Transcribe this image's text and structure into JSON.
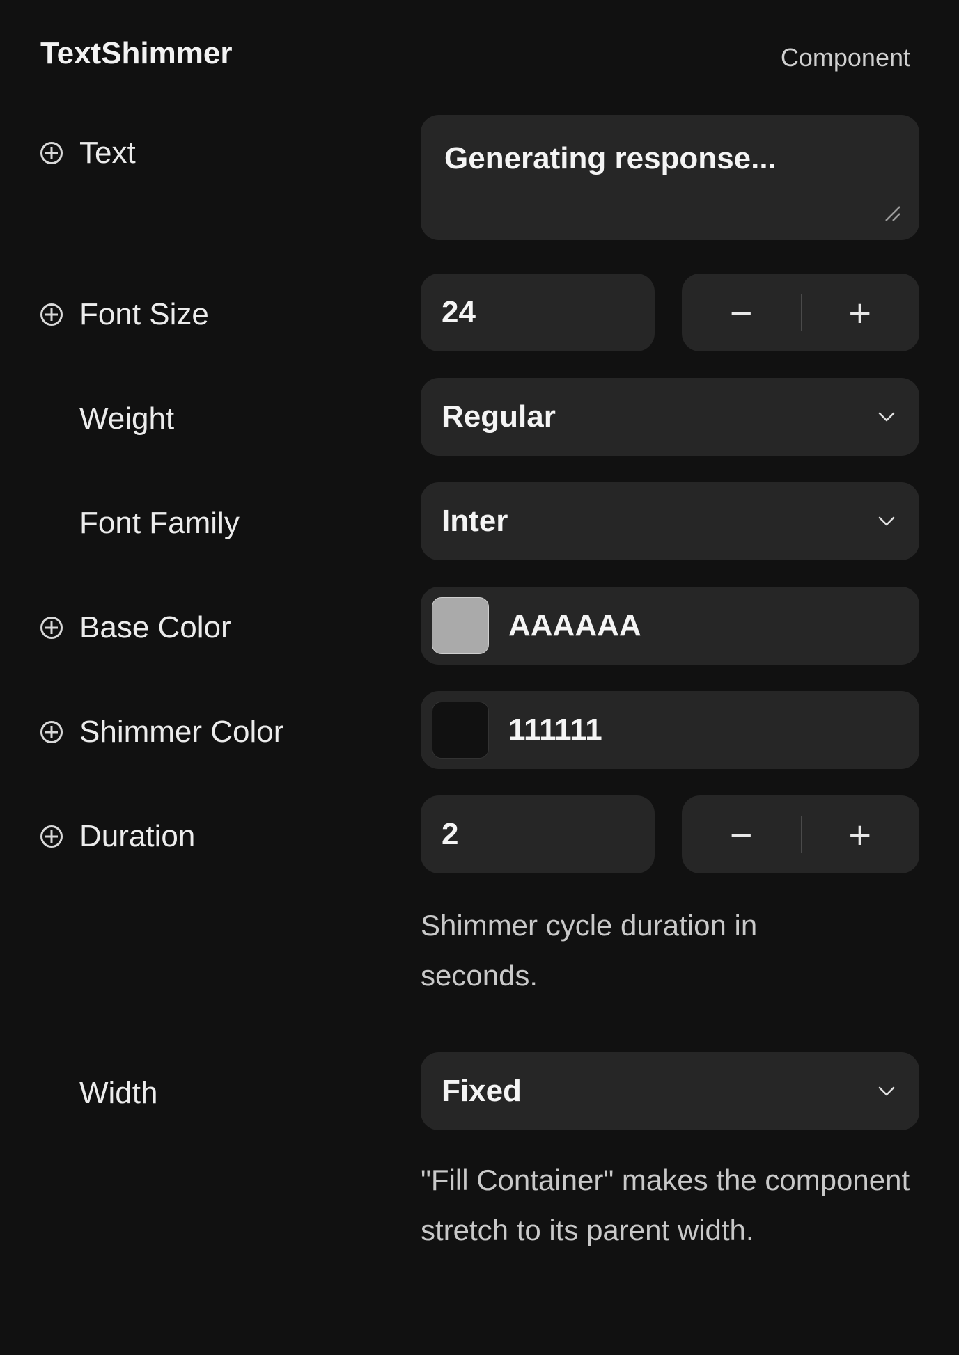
{
  "header": {
    "title": "TextShimmer",
    "subtitle": "Component"
  },
  "properties": {
    "text": {
      "label": "Text",
      "value": "Generating response..."
    },
    "font_size": {
      "label": "Font Size",
      "value": "24",
      "minus": "−",
      "plus": "+"
    },
    "weight": {
      "label": "Weight",
      "value": "Regular"
    },
    "font_family": {
      "label": "Font Family",
      "value": "Inter"
    },
    "base_color": {
      "label": "Base Color",
      "value": "AAAAAA",
      "swatch": "#AAAAAA"
    },
    "shimmer_color": {
      "label": "Shimmer Color",
      "value": "111111",
      "swatch": "#111111"
    },
    "duration": {
      "label": "Duration",
      "value": "2",
      "minus": "−",
      "plus": "+",
      "help": "Shimmer cycle duration in seconds."
    },
    "width": {
      "label": "Width",
      "value": "Fixed",
      "help": "\"Fill Container\" makes the component stretch to its parent width."
    }
  },
  "colors": {
    "background": "#111111",
    "field": "#262626",
    "text": "#ececec",
    "muted": "#c9c9c9"
  },
  "icons": {
    "add": "plus-circle-icon",
    "dropdown": "chevron-down-icon",
    "resize": "resize-handle-icon"
  }
}
